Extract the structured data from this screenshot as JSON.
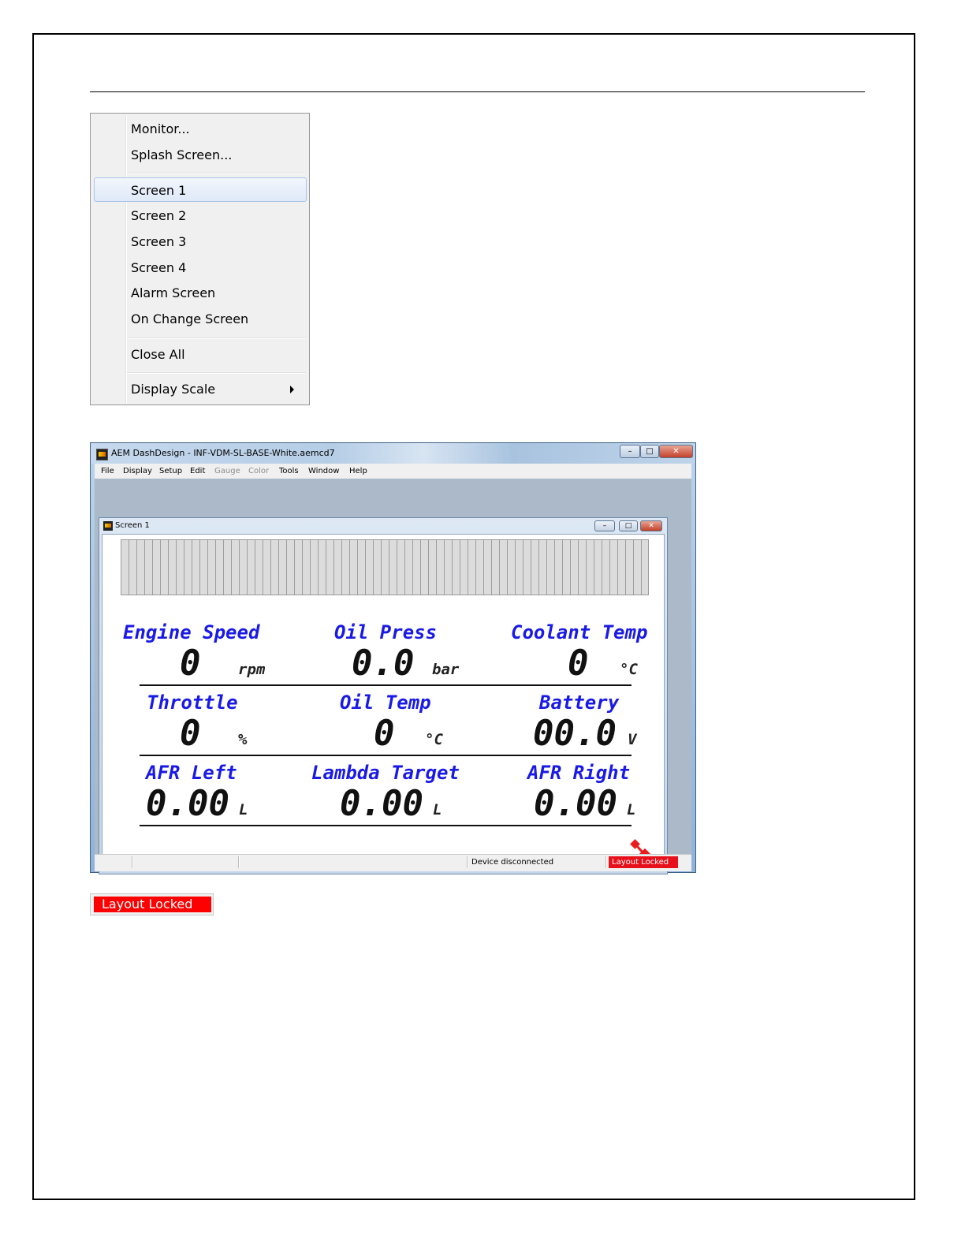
{
  "context_menu": {
    "items": [
      {
        "label": "Monitor..."
      },
      {
        "label": "Splash Screen..."
      },
      {
        "label": "Screen 1"
      },
      {
        "label": "Screen 2"
      },
      {
        "label": "Screen 3"
      },
      {
        "label": "Screen 4"
      },
      {
        "label": "Alarm Screen"
      },
      {
        "label": "On Change Screen"
      },
      {
        "label": "Close All"
      },
      {
        "label": "Display Scale"
      }
    ],
    "highlighted": "Screen 1"
  },
  "app_window": {
    "title": "AEM DashDesign - INF-VDM-SL-BASE-White.aemcd7",
    "controls": {
      "minimize": "–",
      "maximize": "□",
      "close": "✕"
    },
    "menubar": {
      "items": [
        "File",
        "Display",
        "Setup",
        "Edit",
        "Gauge",
        "Color",
        "Tools",
        "Window",
        "Help"
      ],
      "disabled": [
        "Gauge",
        "Color"
      ]
    },
    "child_window": {
      "title": "Screen 1",
      "gauges": [
        {
          "label": "Engine Speed",
          "value": "0",
          "unit": "rpm"
        },
        {
          "label": "Oil Press",
          "value": "0.0",
          "unit": "bar"
        },
        {
          "label": "Coolant Temp",
          "value": "0",
          "unit": "°C"
        },
        {
          "label": "Throttle",
          "value": "0",
          "unit": "%"
        },
        {
          "label": "Oil Temp",
          "value": "0",
          "unit": "°C"
        },
        {
          "label": "Battery",
          "value": "00.0",
          "unit": "V"
        },
        {
          "label": "AFR Left",
          "value": "0.00",
          "unit": "L"
        },
        {
          "label": "Lambda Target",
          "value": "0.00",
          "unit": "L"
        },
        {
          "label": "AFR Right",
          "value": "0.00",
          "unit": "L"
        }
      ],
      "gps_icon": "satellite-icon",
      "gps_color": "#e81d1d"
    },
    "statusbar": {
      "device_status": "Device disconnected",
      "layout_status": "Layout Locked"
    }
  },
  "layout_locked_badge": {
    "label": "Layout Locked",
    "color": "#ff0000"
  }
}
